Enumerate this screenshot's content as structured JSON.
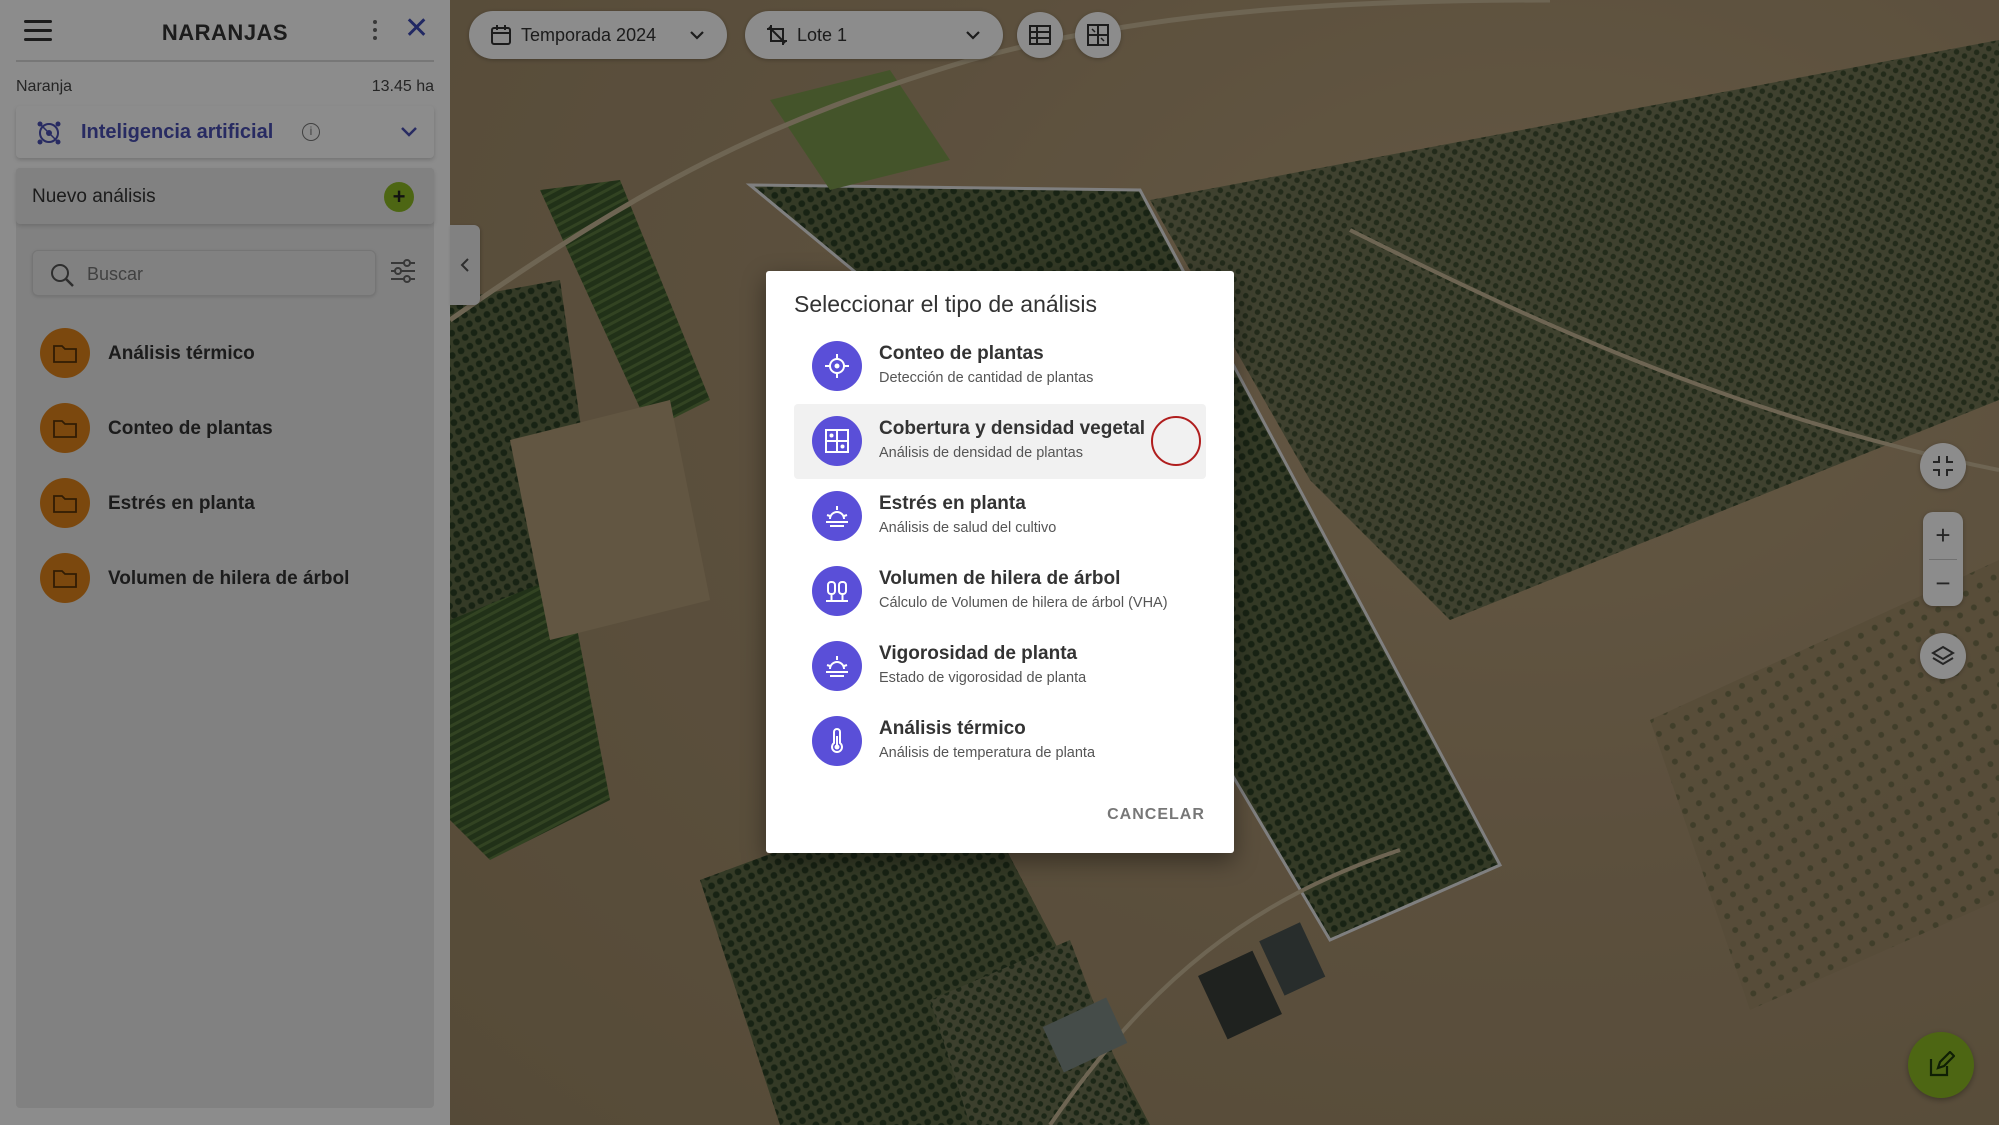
{
  "sidebar": {
    "title": "NARANJAS",
    "crop_name": "Naranja",
    "area": "13.45 ha",
    "ai_section": {
      "label": "Inteligencia artificial",
      "info": "i"
    },
    "new_analysis_label": "Nuevo análisis",
    "search": {
      "placeholder": "Buscar",
      "value": ""
    },
    "folders": [
      {
        "label": "Análisis térmico"
      },
      {
        "label": "Conteo de plantas"
      },
      {
        "label": "Estrés en planta"
      },
      {
        "label": "Volumen de hilera de árbol"
      }
    ]
  },
  "toolbar": {
    "season": "Temporada 2024",
    "lot": "Lote 1"
  },
  "map_controls": {
    "zoom_in": "+",
    "zoom_out": "−"
  },
  "modal": {
    "title": "Seleccionar el tipo de análisis",
    "options": [
      {
        "title": "Conteo de plantas",
        "subtitle": "Detección de cantidad de plantas",
        "icon": "target-icon"
      },
      {
        "title": "Cobertura y densidad vegetal",
        "subtitle": "Análisis de densidad de plantas",
        "icon": "grid-density-icon"
      },
      {
        "title": "Estrés en planta",
        "subtitle": "Análisis de salud del cultivo",
        "icon": "sun-plant-icon"
      },
      {
        "title": "Volumen de hilera de árbol",
        "subtitle": "Cálculo de Volumen de hilera de árbol (VHA)",
        "icon": "tree-volume-icon"
      },
      {
        "title": "Vigorosidad de planta",
        "subtitle": "Estado de vigorosidad de planta",
        "icon": "sun-plant-icon"
      },
      {
        "title": "Análisis térmico",
        "subtitle": "Análisis de temperatura de planta",
        "icon": "thermometer-icon"
      }
    ],
    "cancel_label": "CANCELAR"
  },
  "colors": {
    "accent": "#5a4fd8",
    "brand_green": "#8dbb24",
    "folder_orange": "#e0841a",
    "title_blue": "#4a4fb3"
  }
}
